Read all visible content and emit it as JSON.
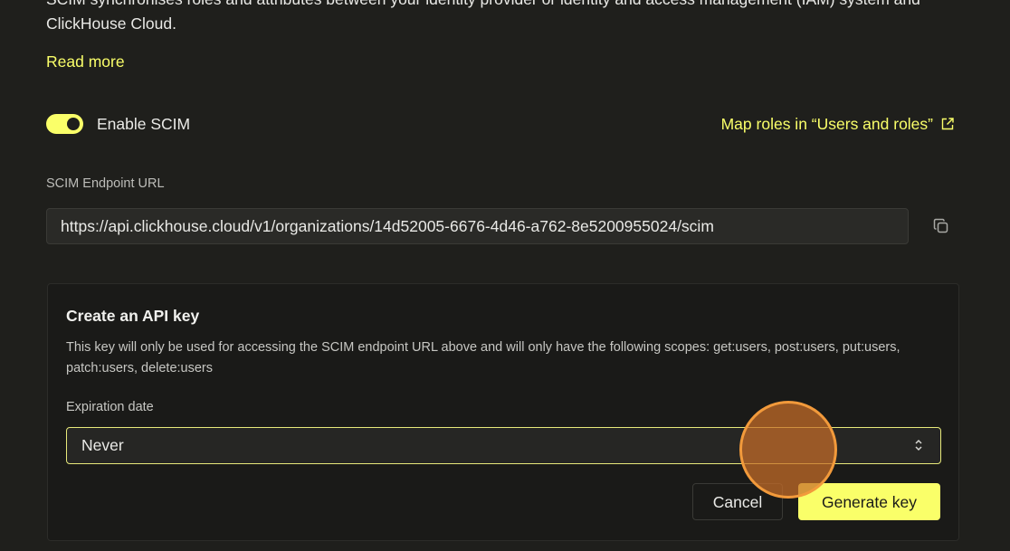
{
  "intro": {
    "description": "SCIM synchronises roles and attributes between your identity provider or identity and access management (IAM) system and ClickHouse Cloud.",
    "read_more": "Read more"
  },
  "scim_toggle": {
    "label": "Enable SCIM",
    "enabled": true
  },
  "map_roles_link": "Map roles in “Users and roles”",
  "endpoint": {
    "label": "SCIM Endpoint URL",
    "url": "https://api.clickhouse.cloud/v1/organizations/14d52005-6676-4d46-a762-8e5200955024/scim"
  },
  "api_key": {
    "title": "Create an API key",
    "description": "This key will only be used for accessing the SCIM endpoint URL above and will only have the following scopes: get:users, post:users, put:users, patch:users, delete:users",
    "expiration_label": "Expiration date",
    "expiration_value": "Never",
    "cancel_label": "Cancel",
    "generate_label": "Generate key"
  },
  "colors": {
    "accent": "#faff69",
    "background": "#1f1f1c",
    "card": "#1a1a18",
    "cursor_highlight": "#f29a3b"
  },
  "icons": {
    "external": "external-link-icon",
    "copy": "copy-icon",
    "select": "chevron-up-down-icon"
  }
}
